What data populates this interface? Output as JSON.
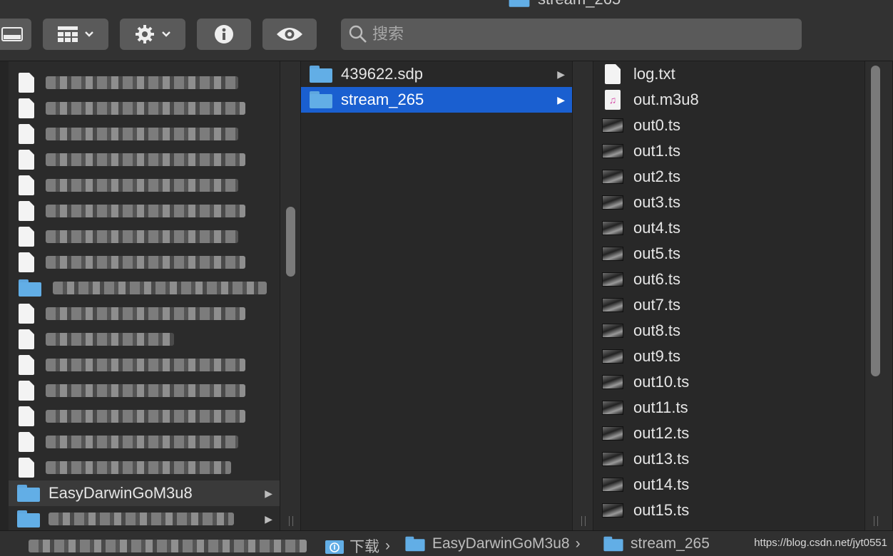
{
  "window": {
    "title": "stream_265"
  },
  "toolbar": {
    "view_button": "view-columns",
    "group_button": "group-by-grid",
    "action_button": "gear-action",
    "info_button": "info",
    "preview_button": "eye-preview",
    "search_placeholder": "搜索"
  },
  "column1": {
    "items": [
      {
        "label": "EasyDarwinGoM3u8",
        "icon": "folder-icon",
        "selected": false,
        "has_children": true
      }
    ]
  },
  "column2": {
    "items": [
      {
        "label": "439622.sdp",
        "icon": "folder-icon",
        "selected": false
      },
      {
        "label": "stream_265",
        "icon": "folder-icon",
        "selected": true
      }
    ]
  },
  "column3": {
    "items": [
      {
        "label": "log.txt",
        "icon": "text-file-icon"
      },
      {
        "label": "out.m3u8",
        "icon": "music-playlist-icon"
      },
      {
        "label": "out0.ts",
        "icon": "video-thumbnail-icon"
      },
      {
        "label": "out1.ts",
        "icon": "video-thumbnail-icon"
      },
      {
        "label": "out2.ts",
        "icon": "video-thumbnail-icon"
      },
      {
        "label": "out3.ts",
        "icon": "video-thumbnail-icon"
      },
      {
        "label": "out4.ts",
        "icon": "video-thumbnail-icon"
      },
      {
        "label": "out5.ts",
        "icon": "video-thumbnail-icon"
      },
      {
        "label": "out6.ts",
        "icon": "video-thumbnail-icon"
      },
      {
        "label": "out7.ts",
        "icon": "video-thumbnail-icon"
      },
      {
        "label": "out8.ts",
        "icon": "video-thumbnail-icon"
      },
      {
        "label": "out9.ts",
        "icon": "video-thumbnail-icon"
      },
      {
        "label": "out10.ts",
        "icon": "video-thumbnail-icon"
      },
      {
        "label": "out11.ts",
        "icon": "video-thumbnail-icon"
      },
      {
        "label": "out12.ts",
        "icon": "video-thumbnail-icon"
      },
      {
        "label": "out13.ts",
        "icon": "video-thumbnail-icon"
      },
      {
        "label": "out14.ts",
        "icon": "video-thumbnail-icon"
      },
      {
        "label": "out15.ts",
        "icon": "video-thumbnail-icon"
      }
    ]
  },
  "pathbar": {
    "crumbs": [
      "下载",
      "EasyDarwinGoM3u8",
      "stream_265"
    ],
    "separator": "›"
  },
  "watermark": "https://blog.csdn.net/jyt0551",
  "colors": {
    "selection": "#1a5fd0",
    "folder": "#62aee6",
    "background": "#282828"
  }
}
